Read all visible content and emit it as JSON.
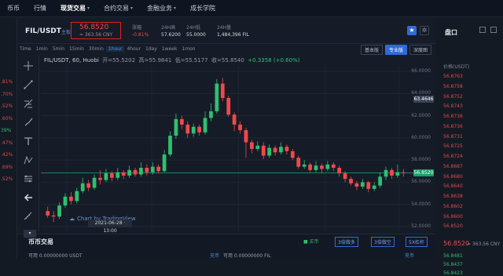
{
  "topnav": {
    "items": [
      {
        "label": "币币",
        "caret": false
      },
      {
        "label": "行情",
        "caret": false
      },
      {
        "label": "现货交易",
        "caret": true
      },
      {
        "label": "合约交易",
        "caret": true
      },
      {
        "label": "金融业务",
        "caret": true
      },
      {
        "label": "成长学院",
        "caret": false
      }
    ]
  },
  "leftstrip": {
    "values": [
      ".81%",
      ".70%",
      ".52%",
      ".60%",
      "39%",
      ".47%",
      ".42%",
      ".69%",
      ".52%"
    ],
    "colors": [
      "#e0484b",
      "#e0484b",
      "#e0484b",
      "#e0484b",
      "#2fbf71",
      "#e0484b",
      "#e0484b",
      "#e0484b",
      "#e0484b"
    ]
  },
  "symbol": {
    "pair": "FIL/USDT",
    "sub": "主板",
    "price": "56.8520",
    "cny": "≈ 363.56 CNY",
    "stats": [
      {
        "key": "涨幅",
        "value": "-0.81%",
        "color": "#f0494b"
      },
      {
        "key": "24H高",
        "value": "57.6200",
        "color": "#d6dae1"
      },
      {
        "key": "24H低",
        "value": "55.0000",
        "color": "#d6dae1"
      },
      {
        "key": "24H量",
        "value": "1,484,396 FIL",
        "color": "#d6dae1"
      }
    ]
  },
  "timeframes": {
    "items": [
      "Time",
      "1min",
      "5min",
      "15min",
      "30min",
      "1hour",
      "4hour",
      "1day",
      "1week",
      "1mon"
    ],
    "selected": "1hour",
    "buttons": [
      {
        "label": "基本版",
        "selected": false
      },
      {
        "label": "专业版",
        "selected": true
      },
      {
        "label": "深度图",
        "selected": false
      }
    ]
  },
  "chart_legend": {
    "title": "FIL/USDT, 60, Huobi",
    "open": "开=55.5202",
    "high": "高=55.9841",
    "low": "低=55.5177",
    "close": "收=55.8540",
    "change": "+0.3358 (+0.60%)"
  },
  "chart_data": {
    "type": "candlestick",
    "y_ticks": [
      "66.0000",
      "64.0000",
      "62.0000",
      "60.0000",
      "58.0000",
      "56.0000",
      "54.0000",
      "52.0000"
    ],
    "ylim": [
      51.5,
      66.5
    ],
    "x_ticks": [
      "28",
      "30",
      "7月",
      "3",
      "14"
    ],
    "current_price": "56.8520",
    "crosshair_price": "63.4646",
    "crosshair_date": "2021-06-28 · 13:00",
    "watermark": "Chart by TradingView",
    "series": [
      {
        "name": "FIL/USDT",
        "ohlc": [
          [
            53.4,
            53.0,
            53.8,
            52.8
          ],
          [
            53.0,
            52.9,
            53.4,
            52.4
          ],
          [
            52.9,
            53.9,
            54.2,
            52.7
          ],
          [
            53.9,
            54.7,
            55.0,
            53.7
          ],
          [
            54.7,
            54.3,
            55.1,
            54.0
          ],
          [
            54.3,
            55.2,
            55.5,
            54.1
          ],
          [
            55.2,
            55.9,
            56.4,
            55.0
          ],
          [
            55.9,
            55.5,
            56.2,
            55.2
          ],
          [
            55.5,
            56.4,
            56.7,
            55.3
          ],
          [
            56.4,
            56.2,
            57.1,
            55.8
          ],
          [
            56.2,
            56.8,
            57.2,
            56.0
          ],
          [
            56.8,
            56.4,
            57.0,
            56.1
          ],
          [
            56.4,
            56.9,
            57.3,
            56.2
          ],
          [
            56.9,
            56.6,
            57.1,
            56.3
          ],
          [
            56.6,
            57.1,
            57.5,
            56.4
          ],
          [
            57.1,
            56.7,
            57.3,
            56.5
          ],
          [
            56.7,
            57.3,
            57.8,
            56.5
          ],
          [
            57.3,
            56.9,
            57.6,
            56.6
          ],
          [
            56.9,
            57.4,
            57.8,
            56.7
          ],
          [
            57.4,
            57.0,
            57.6,
            56.8
          ],
          [
            57.0,
            58.5,
            58.9,
            56.9
          ],
          [
            58.5,
            60.2,
            60.6,
            58.3
          ],
          [
            60.2,
            61.7,
            62.2,
            59.9
          ],
          [
            61.7,
            61.2,
            62.0,
            60.8
          ],
          [
            61.2,
            60.4,
            61.5,
            60.0
          ],
          [
            60.4,
            61.0,
            61.3,
            60.1
          ],
          [
            61.0,
            60.5,
            61.2,
            60.2
          ],
          [
            60.5,
            61.8,
            62.4,
            60.3
          ],
          [
            61.8,
            62.4,
            63.1,
            61.5
          ],
          [
            62.4,
            64.9,
            65.3,
            62.2
          ],
          [
            64.9,
            63.6,
            65.4,
            63.3
          ],
          [
            63.6,
            62.1,
            63.8,
            61.9
          ],
          [
            62.1,
            61.2,
            62.3,
            60.6
          ],
          [
            61.2,
            60.7,
            61.5,
            60.4
          ],
          [
            60.7,
            59.6,
            60.9,
            58.2
          ],
          [
            59.6,
            59.0,
            59.8,
            58.6
          ],
          [
            59.0,
            59.3,
            59.7,
            58.8
          ],
          [
            59.3,
            58.4,
            59.6,
            58.1
          ],
          [
            58.4,
            59.1,
            59.4,
            58.2
          ],
          [
            59.1,
            58.7,
            59.3,
            58.4
          ],
          [
            58.7,
            59.2,
            59.6,
            58.5
          ],
          [
            59.2,
            58.8,
            59.4,
            58.5
          ],
          [
            58.8,
            58.2,
            59.0,
            58.0
          ],
          [
            58.2,
            57.4,
            58.4,
            57.2
          ],
          [
            57.4,
            57.6,
            58.0,
            57.2
          ],
          [
            57.6,
            57.1,
            57.8,
            56.9
          ],
          [
            57.1,
            57.5,
            57.9,
            56.9
          ],
          [
            57.5,
            57.2,
            57.7,
            56.8
          ],
          [
            57.2,
            57.6,
            57.9,
            57.0
          ],
          [
            57.6,
            57.3,
            57.8,
            57.0
          ],
          [
            57.3,
            56.8,
            57.5,
            56.5
          ],
          [
            56.8,
            56.3,
            57.0,
            56.0
          ],
          [
            56.3,
            55.9,
            56.5,
            55.7
          ],
          [
            55.9,
            55.6,
            56.1,
            55.3
          ],
          [
            55.6,
            56.0,
            56.3,
            55.4
          ],
          [
            56.0,
            55.4,
            56.1,
            55.1
          ],
          [
            55.4,
            55.7,
            56.0,
            55.2
          ],
          [
            55.7,
            56.5,
            56.9,
            55.5
          ],
          [
            56.5,
            57.1,
            57.4,
            56.2
          ],
          [
            57.1,
            56.6,
            57.3,
            56.3
          ],
          [
            56.6,
            56.9,
            57.6,
            56.4
          ],
          [
            56.9,
            56.85,
            57.2,
            56.5
          ]
        ]
      }
    ]
  },
  "bottom": {
    "title": "币币交易",
    "buy_tab": "买币",
    "tabs": [
      "3倍做多",
      "3倍做空",
      "5X杠杆"
    ],
    "avail_left": "可用 0.00000000 USDT",
    "avail_right": "可用 0.00000000 FIL",
    "charge_left": "充币",
    "charge_right": "充币",
    "collapse": "▾"
  },
  "orderbook": {
    "title": "盘口",
    "header": "价格(USDT)",
    "asks": [
      "56.8763",
      "56.8758",
      "56.8752",
      "56.8743",
      "56.8736",
      "56.8736",
      "56.8731",
      "56.8725",
      "56.8724",
      "56.8687",
      "56.8680",
      "56.8640",
      "56.8638",
      "56.8602",
      "56.8600",
      "56.8520"
    ],
    "last_price": "56.8520",
    "last_cny": "≈ 363.56 CNY",
    "bids": [
      "56.8481",
      "56.8437",
      "56.8423"
    ]
  },
  "colors": {
    "up": "#2fbf71",
    "down": "#f0494b",
    "accent": "#2f6bd6"
  }
}
